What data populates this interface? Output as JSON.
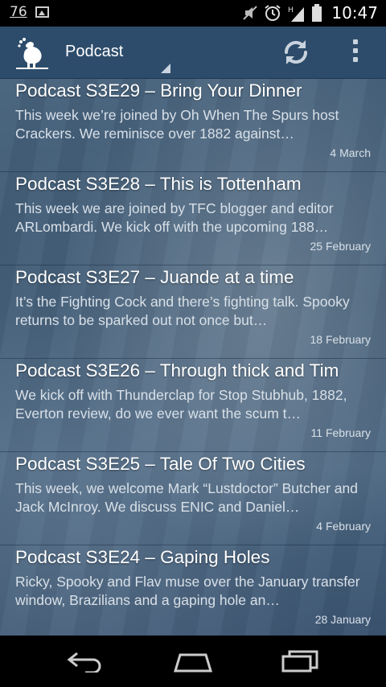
{
  "status_bar": {
    "notification_count": "76",
    "time": "10:47",
    "icons": [
      "notification-count",
      "image-notification-icon",
      "mute-icon",
      "alarm-icon",
      "signal-icon",
      "battery-icon"
    ]
  },
  "action_bar": {
    "title": "Podcast",
    "icons": [
      "cockerel-logo-icon",
      "refresh-icon",
      "overflow-menu-icon"
    ],
    "accent": "#2d4c6b"
  },
  "episodes": [
    {
      "title": "Podcast S3E29 – Bring Your Dinner",
      "description": "This week we’re joined by Oh When The Spurs host Crackers. We reminisce over 1882 against…",
      "date": "4 March"
    },
    {
      "title": "Podcast S3E28 – This is Tottenham",
      "description": "This week we are joined by TFC blogger and editor ARLombardi. We kick off with the upcoming 188…",
      "date": "25 February"
    },
    {
      "title": "Podcast S3E27 – Juande at a time",
      "description": "It’s the Fighting Cock and there’s fighting talk. Spooky returns to be sparked out not once but…",
      "date": "18 February"
    },
    {
      "title": "Podcast S3E26 – Through thick and Tim",
      "description": "We kick off with Thunderclap for Stop Stubhub, 1882, Everton review, do we ever want the scum t…",
      "date": "11 February"
    },
    {
      "title": "Podcast S3E25 – Tale Of Two Cities",
      "description": "This week, we welcome Mark “Lustdoctor” Butcher and Jack McInroy. We discuss ENIC and Daniel…",
      "date": "4 February"
    },
    {
      "title": "Podcast S3E24 – Gaping Holes",
      "description": "Ricky, Spooky and Flav muse over the January transfer window, Brazilians and a gaping hole an…",
      "date": "28 January"
    }
  ],
  "nav_bar": {
    "icons": [
      "back-icon",
      "home-icon",
      "recents-icon"
    ]
  }
}
